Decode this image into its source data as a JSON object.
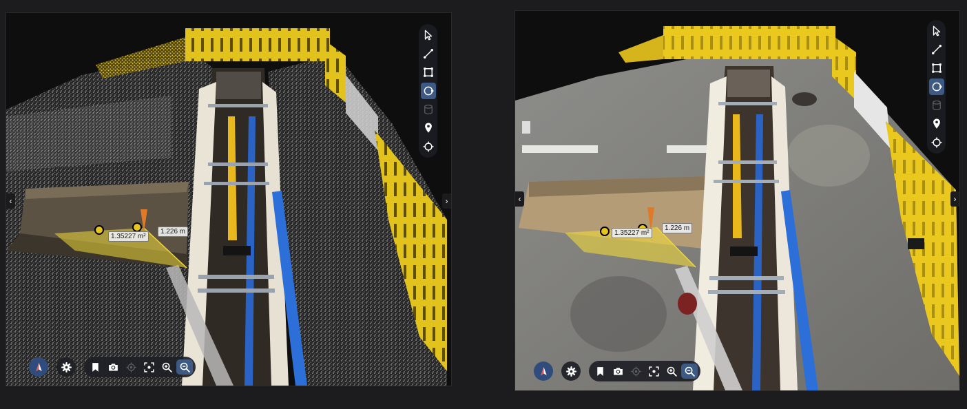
{
  "colors": {
    "background": "#1c1c1e",
    "accent": "#3d5a84",
    "barrier_yellow": "#e2c21c",
    "pipe_yellow": "#e8b81c",
    "pipe_blue": "#2a63c4",
    "area_fill": "#f0d83a"
  },
  "viewers": [
    {
      "name": "point-cloud-view",
      "area_label": "1.35227 m²",
      "distance_label": "1.226 m"
    },
    {
      "name": "textured-mesh-view",
      "area_label": "1.35227 m²",
      "distance_label": "1.226 m"
    }
  ],
  "toolbar_tools": [
    {
      "icon": "cursor-icon",
      "state": "normal"
    },
    {
      "icon": "line-measure-icon",
      "state": "normal"
    },
    {
      "icon": "area-measure-icon",
      "state": "normal"
    },
    {
      "icon": "circle-measure-icon",
      "state": "active"
    },
    {
      "icon": "volume-icon",
      "state": "disabled"
    },
    {
      "icon": "location-pin-icon",
      "state": "normal"
    },
    {
      "icon": "crosshair-icon",
      "state": "normal"
    }
  ],
  "bottom_controls": [
    {
      "icon": "compass-icon"
    },
    {
      "icon": "gear-icon"
    },
    {
      "icon": "bookmark-icon"
    },
    {
      "icon": "camera-icon"
    },
    {
      "icon": "target-icon",
      "state": "disabled"
    },
    {
      "icon": "focus-icon"
    },
    {
      "icon": "zoom-in-icon"
    },
    {
      "icon": "zoom-out-icon",
      "state": "active"
    }
  ],
  "nav_arrows": {
    "left": "‹",
    "right": "›"
  }
}
